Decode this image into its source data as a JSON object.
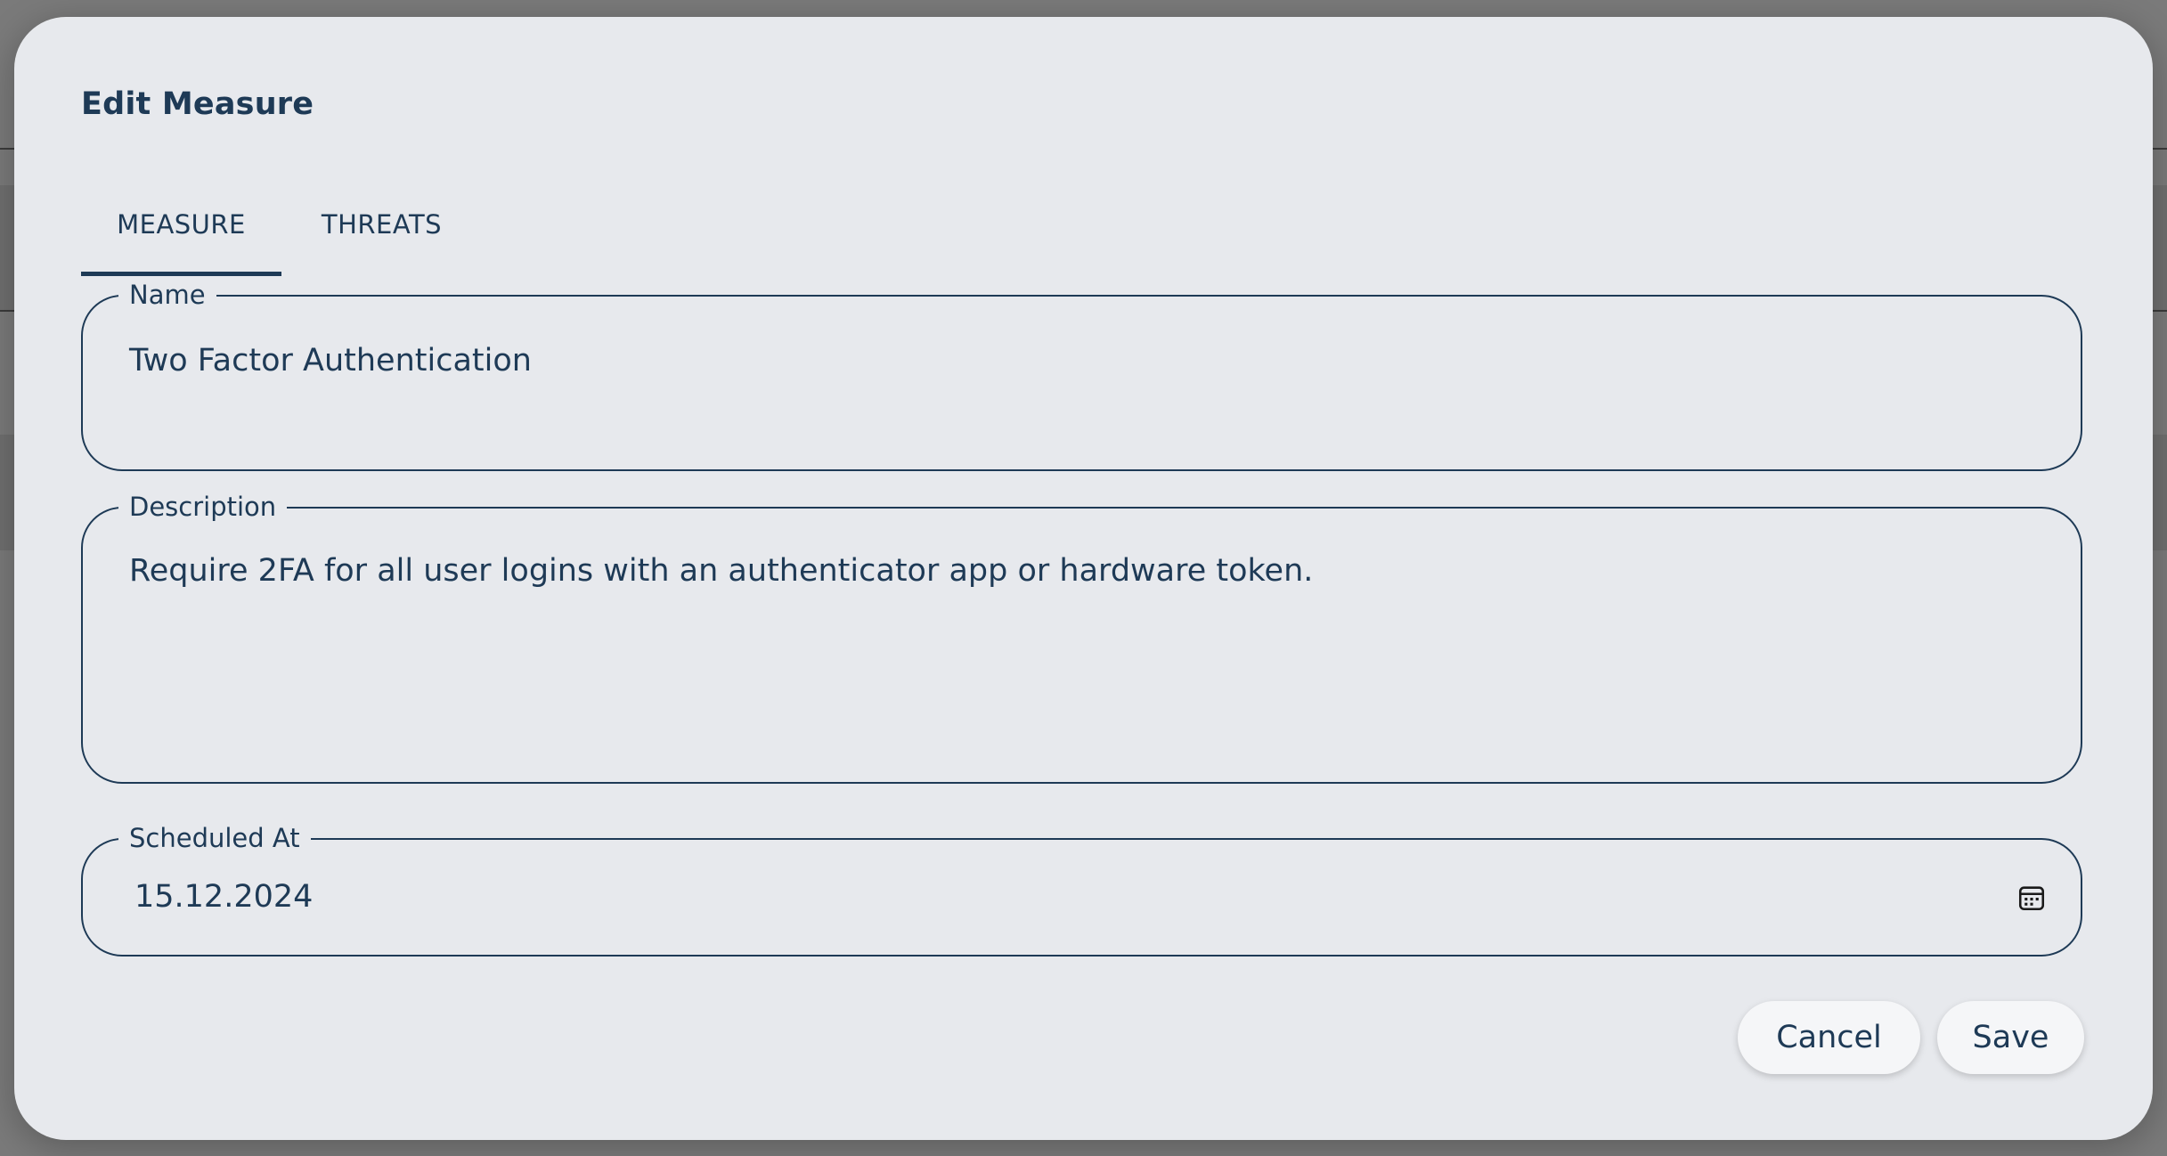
{
  "dialog": {
    "title": "Edit Measure",
    "tabs": [
      {
        "label": "MEASURE",
        "active": true
      },
      {
        "label": "THREATS",
        "active": false
      }
    ],
    "fields": {
      "name": {
        "label": "Name",
        "value": "Two Factor Authentication"
      },
      "description": {
        "label": "Description",
        "value": "Require 2FA for all user logins with an authenticator app or hardware token."
      },
      "scheduled_at": {
        "label": "Scheduled At",
        "value": "15.12.2024",
        "icon": "calendar-icon"
      }
    },
    "actions": {
      "cancel_label": "Cancel",
      "save_label": "Save"
    }
  },
  "colors": {
    "primary": "#1e3a56",
    "dialog_bg": "#e7e9ed",
    "button_bg": "#f5f6f8",
    "overlay": "#777777"
  }
}
